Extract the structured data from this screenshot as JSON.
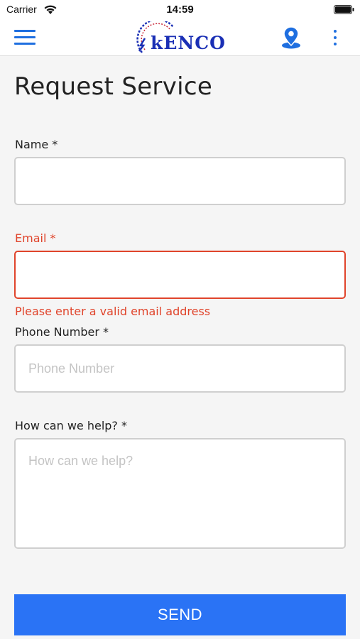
{
  "status_bar": {
    "carrier": "Carrier",
    "time": "14:59"
  },
  "header": {
    "logo_text": "kENCO",
    "icons": {
      "menu": "hamburger-menu-icon",
      "location": "map-pin-icon",
      "more": "more-vertical-icon"
    },
    "accent_color": "#1f6fe0"
  },
  "page": {
    "title": "Request Service"
  },
  "form": {
    "name": {
      "label": "Name *",
      "value": "",
      "placeholder": ""
    },
    "email": {
      "label": "Email *",
      "value": "",
      "placeholder": "",
      "error": "Please enter a valid email address"
    },
    "phone": {
      "label": "Phone Number *",
      "value": "",
      "placeholder": "Phone Number"
    },
    "help": {
      "label": "How can we help? *",
      "value": "",
      "placeholder": "How can we help?"
    },
    "send_label": "SEND"
  },
  "colors": {
    "error": "#e0442b",
    "button": "#2a73f5",
    "brand": "#1a2fb5"
  }
}
